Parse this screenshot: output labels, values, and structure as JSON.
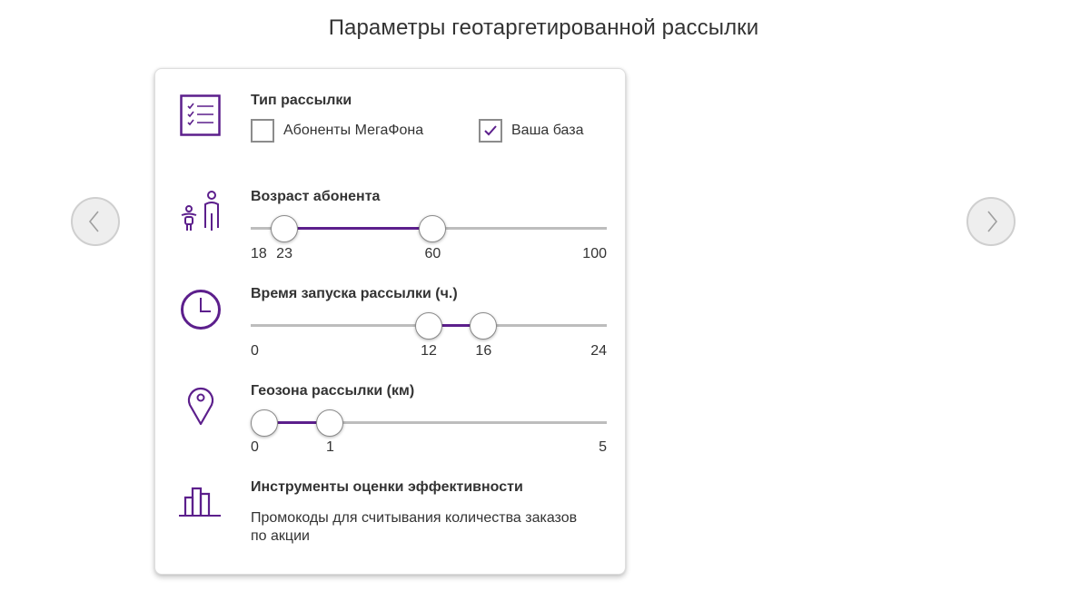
{
  "title": "Параметры геотаргетированной рассылки",
  "nav": {
    "prev_icon": "chevron-left-icon",
    "next_icon": "chevron-right-icon"
  },
  "colors": {
    "accent": "#5c1f8c",
    "track": "#bdbdbd",
    "text": "#333333"
  },
  "mailing_type": {
    "icon": "checklist-icon",
    "label": "Тип рассылки",
    "options": [
      {
        "label": "Абоненты МегаФона",
        "checked": false
      },
      {
        "label": "Ваша база",
        "checked": true
      }
    ]
  },
  "age": {
    "icon": "parent-child-icon",
    "label": "Возраст абонента",
    "min": 18,
    "max": 100,
    "from": 23,
    "to": 60,
    "ticks": {
      "min": "18",
      "from": "23",
      "to": "60",
      "max": "100"
    }
  },
  "launch_time": {
    "icon": "clock-icon",
    "label": "Время запуска рассылки (ч.)",
    "min": 0,
    "max": 24,
    "from": 12,
    "to": 16,
    "ticks": {
      "min": "0",
      "from": "12",
      "to": "16",
      "max": "24"
    }
  },
  "geozone": {
    "icon": "location-pin-icon",
    "label": "Геозона рассылки (км)",
    "min": 0,
    "max": 5,
    "from": 0,
    "to": 1,
    "ticks": {
      "min": "0",
      "to": "1",
      "max": "5"
    }
  },
  "tools": {
    "icon": "bar-chart-icon",
    "label": "Инструменты оценки эффективности",
    "description": "Промокоды для считывания количества заказов по акции"
  }
}
